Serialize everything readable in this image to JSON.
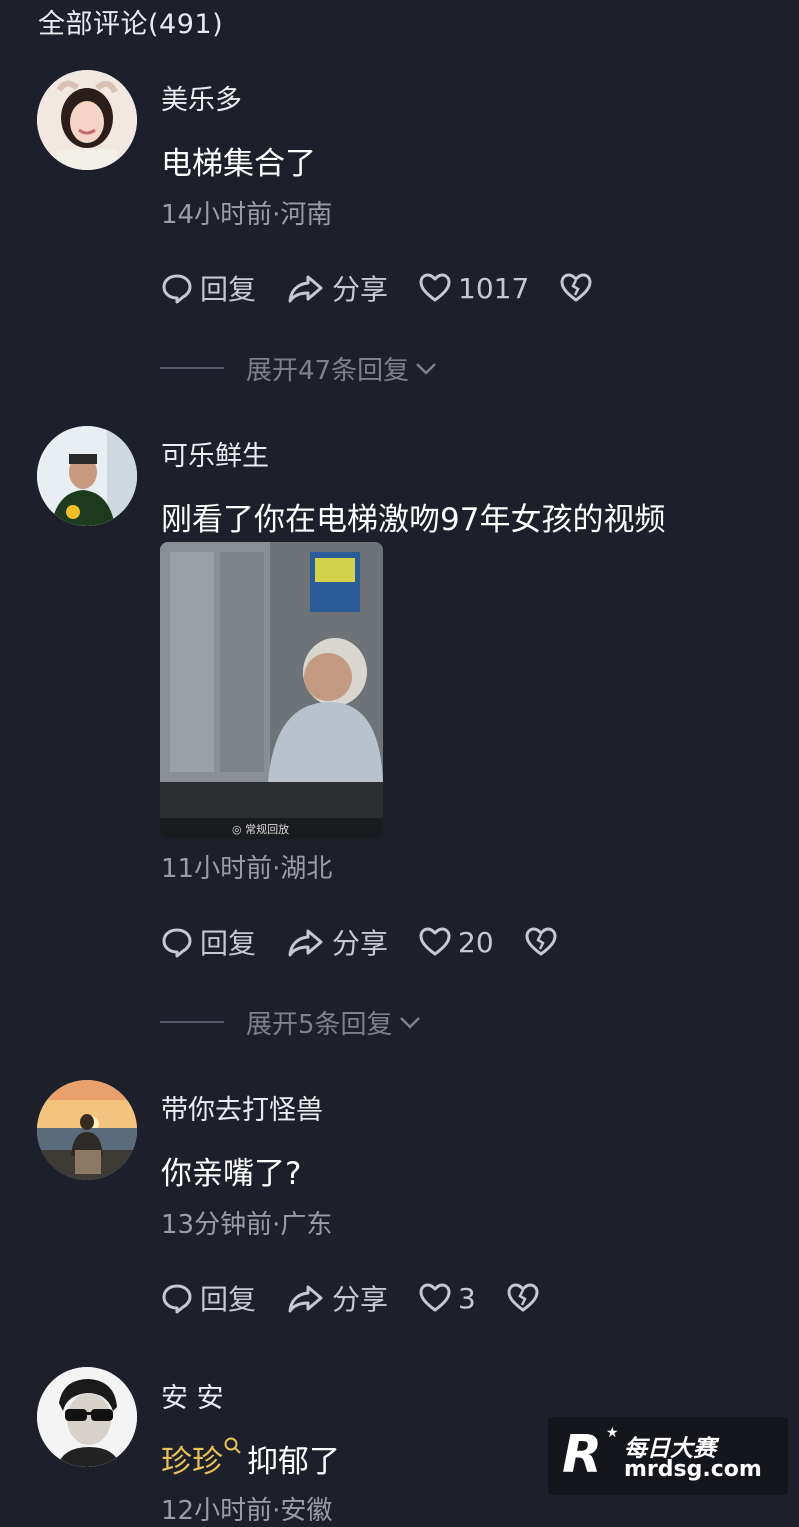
{
  "header": {
    "title": "全部评论(491)"
  },
  "comments": [
    {
      "username": "美乐多",
      "text": "电梯集合了",
      "meta": "14小时前·河南",
      "reply_label": "回复",
      "share_label": "分享",
      "likes": "1017",
      "expand_label": "展开47条回复"
    },
    {
      "username": "可乐鲜生",
      "text": "刚看了你在电梯激吻97年女孩的视频",
      "meta": "11小时前·湖北",
      "reply_label": "回复",
      "share_label": "分享",
      "likes": "20",
      "expand_label": "展开5条回复",
      "image_caption": "◎ 常规回放"
    },
    {
      "username": "带你去打怪兽",
      "text": "你亲嘴了?",
      "meta": "13分钟前·广东",
      "reply_label": "回复",
      "share_label": "分享",
      "likes": "3"
    },
    {
      "username": "安 安",
      "mention": "珍珍",
      "text": "抑郁了",
      "meta": "12小时前·安徽"
    }
  ],
  "watermark": {
    "brand": "每日大赛",
    "url": "mrdsg.com",
    "letter": "R"
  }
}
